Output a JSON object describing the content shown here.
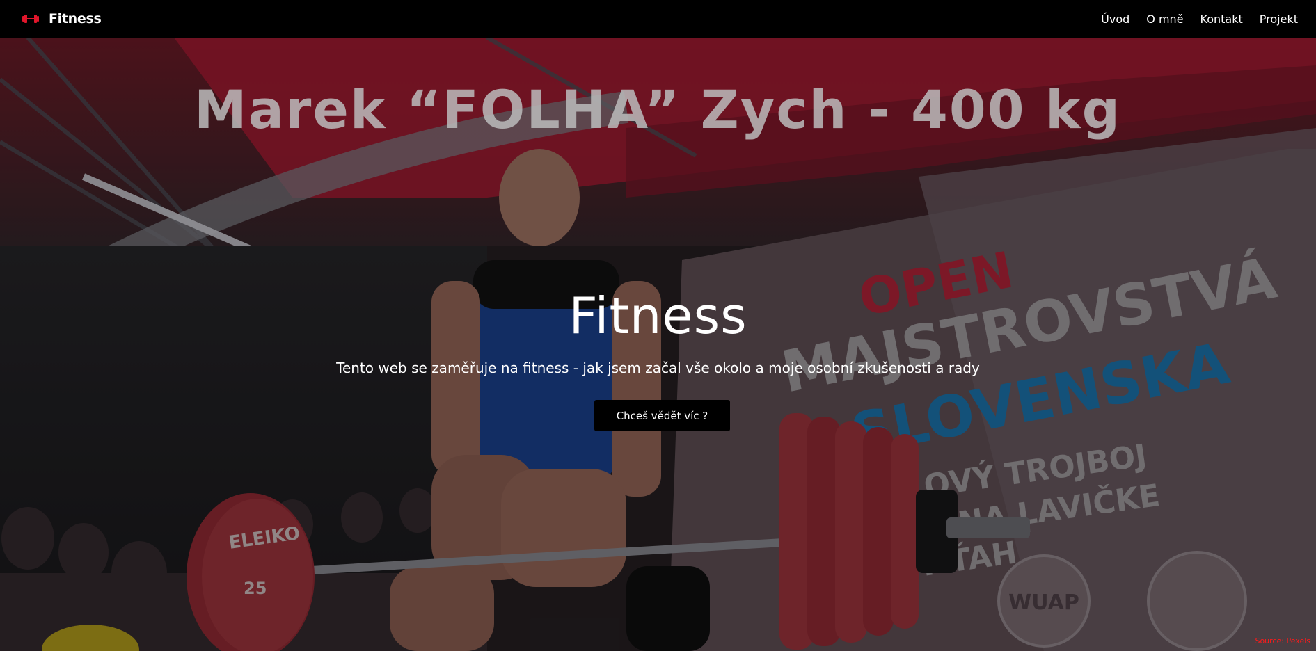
{
  "navbar": {
    "brand_icon": "dumbbell-icon",
    "brand_name": "Fitness",
    "links": [
      {
        "label": "Úvod"
      },
      {
        "label": "O mně"
      },
      {
        "label": "Kontakt"
      },
      {
        "label": "Projekt"
      }
    ]
  },
  "hero": {
    "banner_text": "Marek “FOLHA” Zych - 400 kg",
    "title": "Fitness",
    "subtitle": "Tento web se zaměřuje na fitness - jak jsem začal vše okolo a moje osobní zkušenosti a rady",
    "cta_label": "Chceš vědět víc ?",
    "banner_words": [
      "OPEN",
      "MAJSTROVSTVÁ",
      "SLOVENSKA",
      "OVÝ TROJBOJ",
      "K NA LAVIČKE",
      "Y ŤAH"
    ],
    "plate_brand": "ELEIKO",
    "plate_weight": "25",
    "logo_text": "WUAP",
    "source_credit": "Source: Pexels"
  },
  "colors": {
    "accent": "#e0162b",
    "nav_bg": "#000000",
    "cta_bg": "#000000",
    "banner_blue": "#1f84c4"
  }
}
